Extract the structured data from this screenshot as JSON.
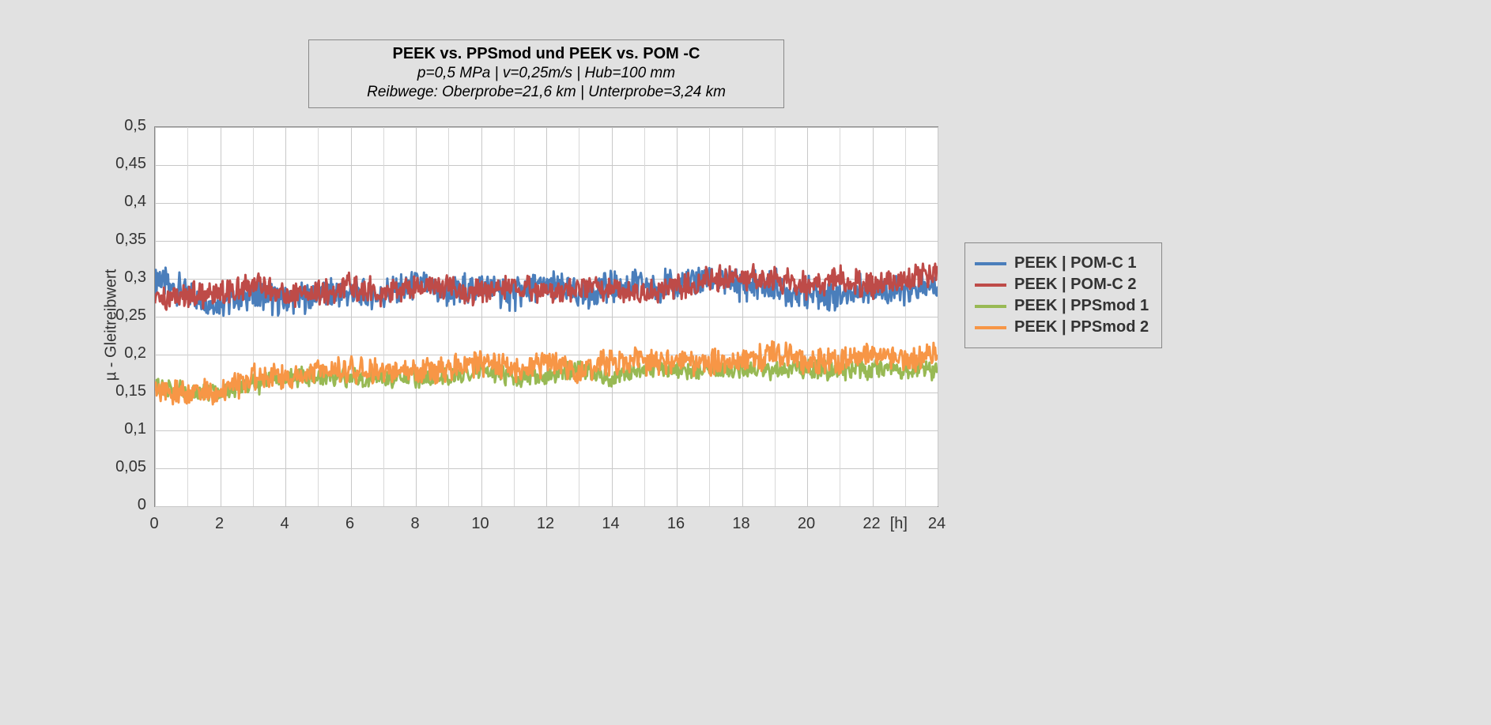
{
  "chart_data": {
    "type": "line",
    "title": "PEEK vs. PPSmod und PEEK vs. POM -C",
    "subtitle1": "p=0,5 MPa | v=0,25m/s | Hub=100 mm",
    "subtitle2": "Reibwege: Oberprobe=21,6 km | Unterprobe=3,24 km",
    "ylabel": "µ - Gleitreibwert",
    "xunit": "[h]",
    "xlim": [
      0,
      24
    ],
    "ylim": [
      0,
      0.5
    ],
    "x_ticks": [
      "0",
      "2",
      "4",
      "6",
      "8",
      "10",
      "12",
      "14",
      "16",
      "18",
      "20",
      "22",
      "24"
    ],
    "y_ticks": [
      "0",
      "0,05",
      "0,1",
      "0,15",
      "0,2",
      "0,25",
      "0,3",
      "0,35",
      "0,4",
      "0,45",
      "0,5"
    ],
    "x": [
      0,
      1,
      2,
      3,
      4,
      5,
      6,
      7,
      8,
      9,
      10,
      11,
      12,
      13,
      14,
      15,
      16,
      17,
      18,
      19,
      20,
      21,
      22,
      23,
      24
    ],
    "series": [
      {
        "name": "PEEK | POM-C 1",
        "color": "#4a7ebb",
        "values": [
          0.3,
          0.28,
          0.27,
          0.28,
          0.27,
          0.28,
          0.28,
          0.28,
          0.29,
          0.28,
          0.29,
          0.28,
          0.29,
          0.28,
          0.29,
          0.29,
          0.29,
          0.3,
          0.29,
          0.29,
          0.28,
          0.28,
          0.29,
          0.28,
          0.29
        ]
      },
      {
        "name": "PEEK | POM-C 2",
        "color": "#be4b48",
        "values": [
          0.27,
          0.28,
          0.28,
          0.29,
          0.28,
          0.28,
          0.29,
          0.28,
          0.29,
          0.29,
          0.28,
          0.29,
          0.28,
          0.29,
          0.29,
          0.28,
          0.29,
          0.3,
          0.3,
          0.3,
          0.29,
          0.3,
          0.29,
          0.3,
          0.31
        ]
      },
      {
        "name": "PEEK | PPSmod 1",
        "color": "#98b954",
        "values": [
          0.16,
          0.15,
          0.15,
          0.16,
          0.17,
          0.17,
          0.17,
          0.17,
          0.17,
          0.17,
          0.18,
          0.17,
          0.17,
          0.18,
          0.17,
          0.18,
          0.18,
          0.18,
          0.18,
          0.18,
          0.18,
          0.18,
          0.18,
          0.18,
          0.18
        ]
      },
      {
        "name": "PEEK | PPSmod 2",
        "color": "#f79646",
        "values": [
          0.15,
          0.15,
          0.15,
          0.17,
          0.17,
          0.18,
          0.18,
          0.18,
          0.18,
          0.18,
          0.19,
          0.18,
          0.19,
          0.18,
          0.19,
          0.19,
          0.19,
          0.19,
          0.19,
          0.2,
          0.19,
          0.19,
          0.2,
          0.19,
          0.2
        ]
      }
    ],
    "noise_amplitude": {
      "PEEK | POM-C 1": 0.025,
      "PEEK | POM-C 2": 0.02,
      "PEEK | PPSmod 1": 0.015,
      "PEEK | PPSmod 2": 0.02
    }
  }
}
